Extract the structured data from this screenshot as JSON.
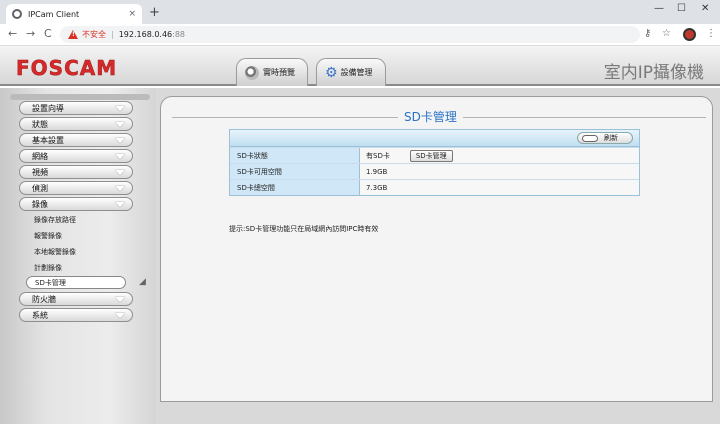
{
  "browser": {
    "tab_title": "IPCam Client",
    "tab_close": "×",
    "new_tab": "+",
    "minimize": "—",
    "maximize": "☐",
    "close": "✕",
    "back": "←",
    "forward": "→",
    "reload": "C",
    "security_text": "不安全",
    "separator": "|",
    "url_host": "192.168.0.46",
    "url_port": ":88",
    "key_icon": "⚷",
    "star_icon": "☆",
    "menu_icon": "⋮"
  },
  "header": {
    "logo": "FOSCAM",
    "tabs": [
      {
        "label": "實時預覽"
      },
      {
        "label": "設備管理"
      }
    ],
    "brand_title": "室内IP攝像機"
  },
  "sidebar": {
    "menus_top": [
      {
        "label": "設置向導"
      },
      {
        "label": "狀態"
      },
      {
        "label": "基本設置"
      },
      {
        "label": "網絡"
      },
      {
        "label": "視頻"
      },
      {
        "label": "偵測"
      },
      {
        "label": "錄像"
      }
    ],
    "submenu": [
      {
        "label": "錄像存放路徑"
      },
      {
        "label": "報警錄像"
      },
      {
        "label": "本地報警錄像"
      },
      {
        "label": "計劃錄像"
      }
    ],
    "selected_submenu": "SD卡管理",
    "menus_bottom": [
      {
        "label": "防火牆"
      },
      {
        "label": "系統"
      }
    ]
  },
  "main": {
    "title": "SD卡管理",
    "refresh_label": "刷新",
    "rows": [
      {
        "label": "SD卡狀態",
        "value": "有SD卡",
        "button": "SD卡管理"
      },
      {
        "label": "SD卡可用空間",
        "value": "1.9GB"
      },
      {
        "label": "SD卡總空間",
        "value": "7.3GB"
      }
    ],
    "tip": "提示:SD卡管理功能只在局域網內訪問IPC時有效"
  },
  "colors": {
    "logo_red": "#d62a2a",
    "title_blue": "#2a73c5",
    "warning_red": "#d93025"
  }
}
